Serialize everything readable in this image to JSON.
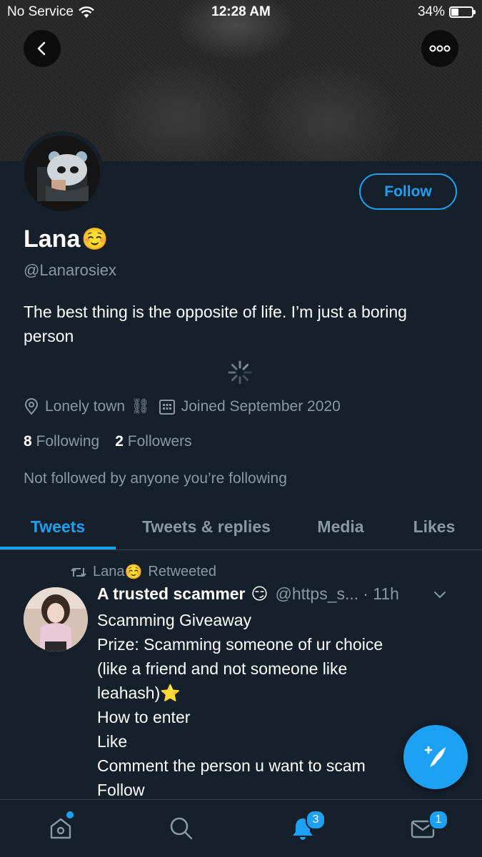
{
  "status_bar": {
    "carrier": "No Service",
    "time": "12:28 AM",
    "battery": "34%",
    "battery_level": 0.34
  },
  "profile": {
    "display_name": "Lana",
    "name_emoji": "☺️",
    "handle": "@Lanarosiex",
    "bio": "The best thing is the opposite of life. I’m just a boring person",
    "location": "Lonely town",
    "location_emoji": "⛓",
    "joined": "Joined September 2020",
    "following_count": "8",
    "following_label": "Following",
    "followers_count": "2",
    "followers_label": "Followers",
    "not_followed": "Not followed by anyone you’re following",
    "follow_label": "Follow"
  },
  "tabs": [
    {
      "label": "Tweets",
      "active": true
    },
    {
      "label": "Tweets & replies",
      "active": false
    },
    {
      "label": "Media",
      "active": false
    },
    {
      "label": "Likes",
      "active": false
    }
  ],
  "tweet": {
    "retweeted_by": "Lana",
    "retweeted_by_emoji": "☺️",
    "retweeted_label": "Retweeted",
    "author": "A trusted scammer",
    "author_emoji": "😏",
    "handle": "@https_s...",
    "time": "· 11h",
    "lines": [
      "Scamming Giveaway",
      "Prize: Scamming someone of ur choice",
      "(like a friend and not someone like",
      "leahash)⭐",
      "How to enter",
      "Like",
      "Comment the person u want to scam",
      "Follow"
    ]
  },
  "bottom_nav": {
    "notifications_badge": "3",
    "messages_badge": "1"
  },
  "icons": [
    "wifi-icon",
    "battery-icon",
    "back-icon",
    "more-icon",
    "location-icon",
    "calendar-icon",
    "retweet-icon",
    "chevron-down-icon",
    "compose-icon",
    "home-icon",
    "search-icon",
    "bell-icon",
    "mail-icon"
  ],
  "colors": {
    "background": "#15202b",
    "accent": "#1da1f2",
    "secondary_text": "#8899a6"
  }
}
